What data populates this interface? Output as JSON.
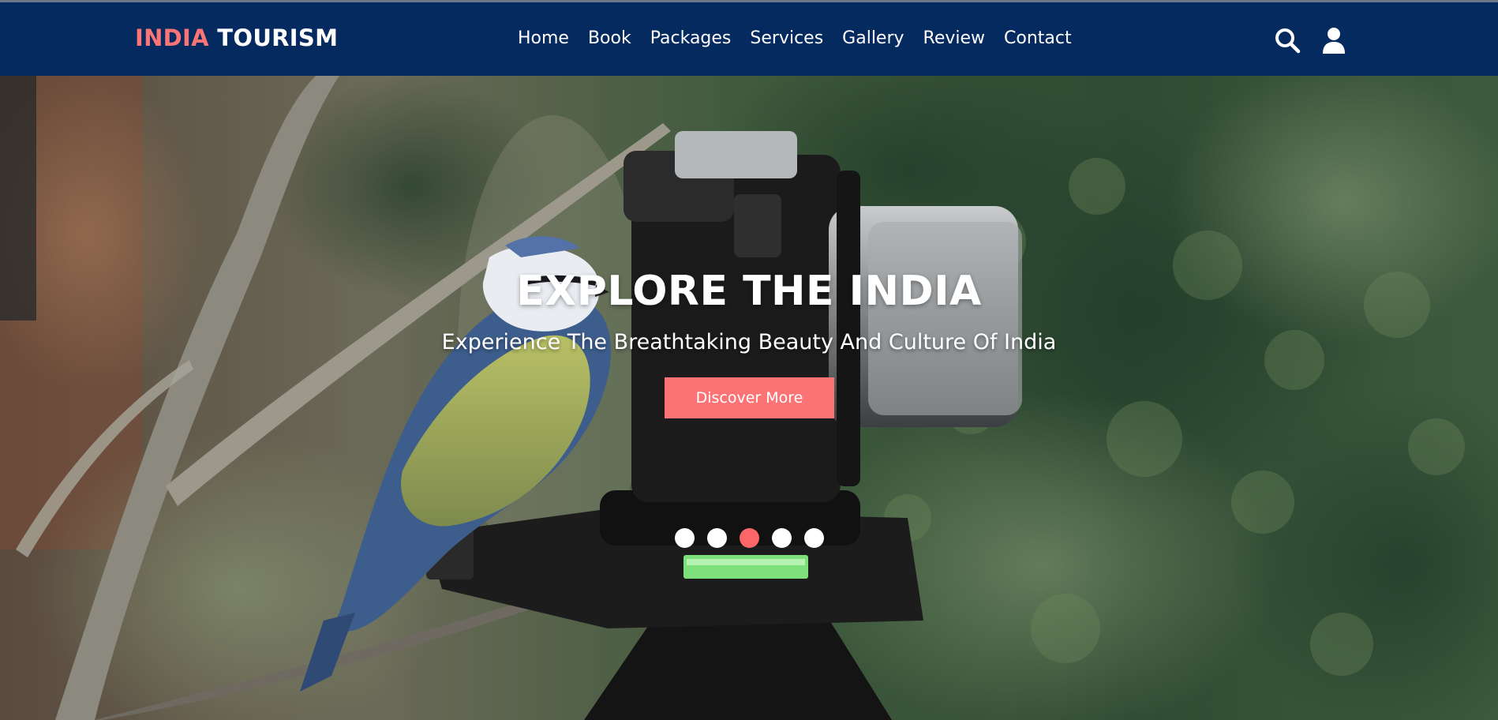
{
  "brand": {
    "part1": "INDIA",
    "part2": "TOURISM"
  },
  "nav": {
    "items": [
      {
        "label": "Home"
      },
      {
        "label": "Book"
      },
      {
        "label": "Packages"
      },
      {
        "label": "Services"
      },
      {
        "label": "Gallery"
      },
      {
        "label": "Review"
      },
      {
        "label": "Contact"
      }
    ]
  },
  "header_icons": [
    "search-icon",
    "user-icon"
  ],
  "hero": {
    "title": "EXPLORE THE INDIA",
    "subtitle": "Experience The Breathtaking Beauty And Culture Of India",
    "cta_label": "Discover More",
    "slides_count": 5,
    "active_slide": 3
  },
  "colors": {
    "navbar": "#052a5f",
    "accent": "#fc7375",
    "text": "#ffffff"
  }
}
